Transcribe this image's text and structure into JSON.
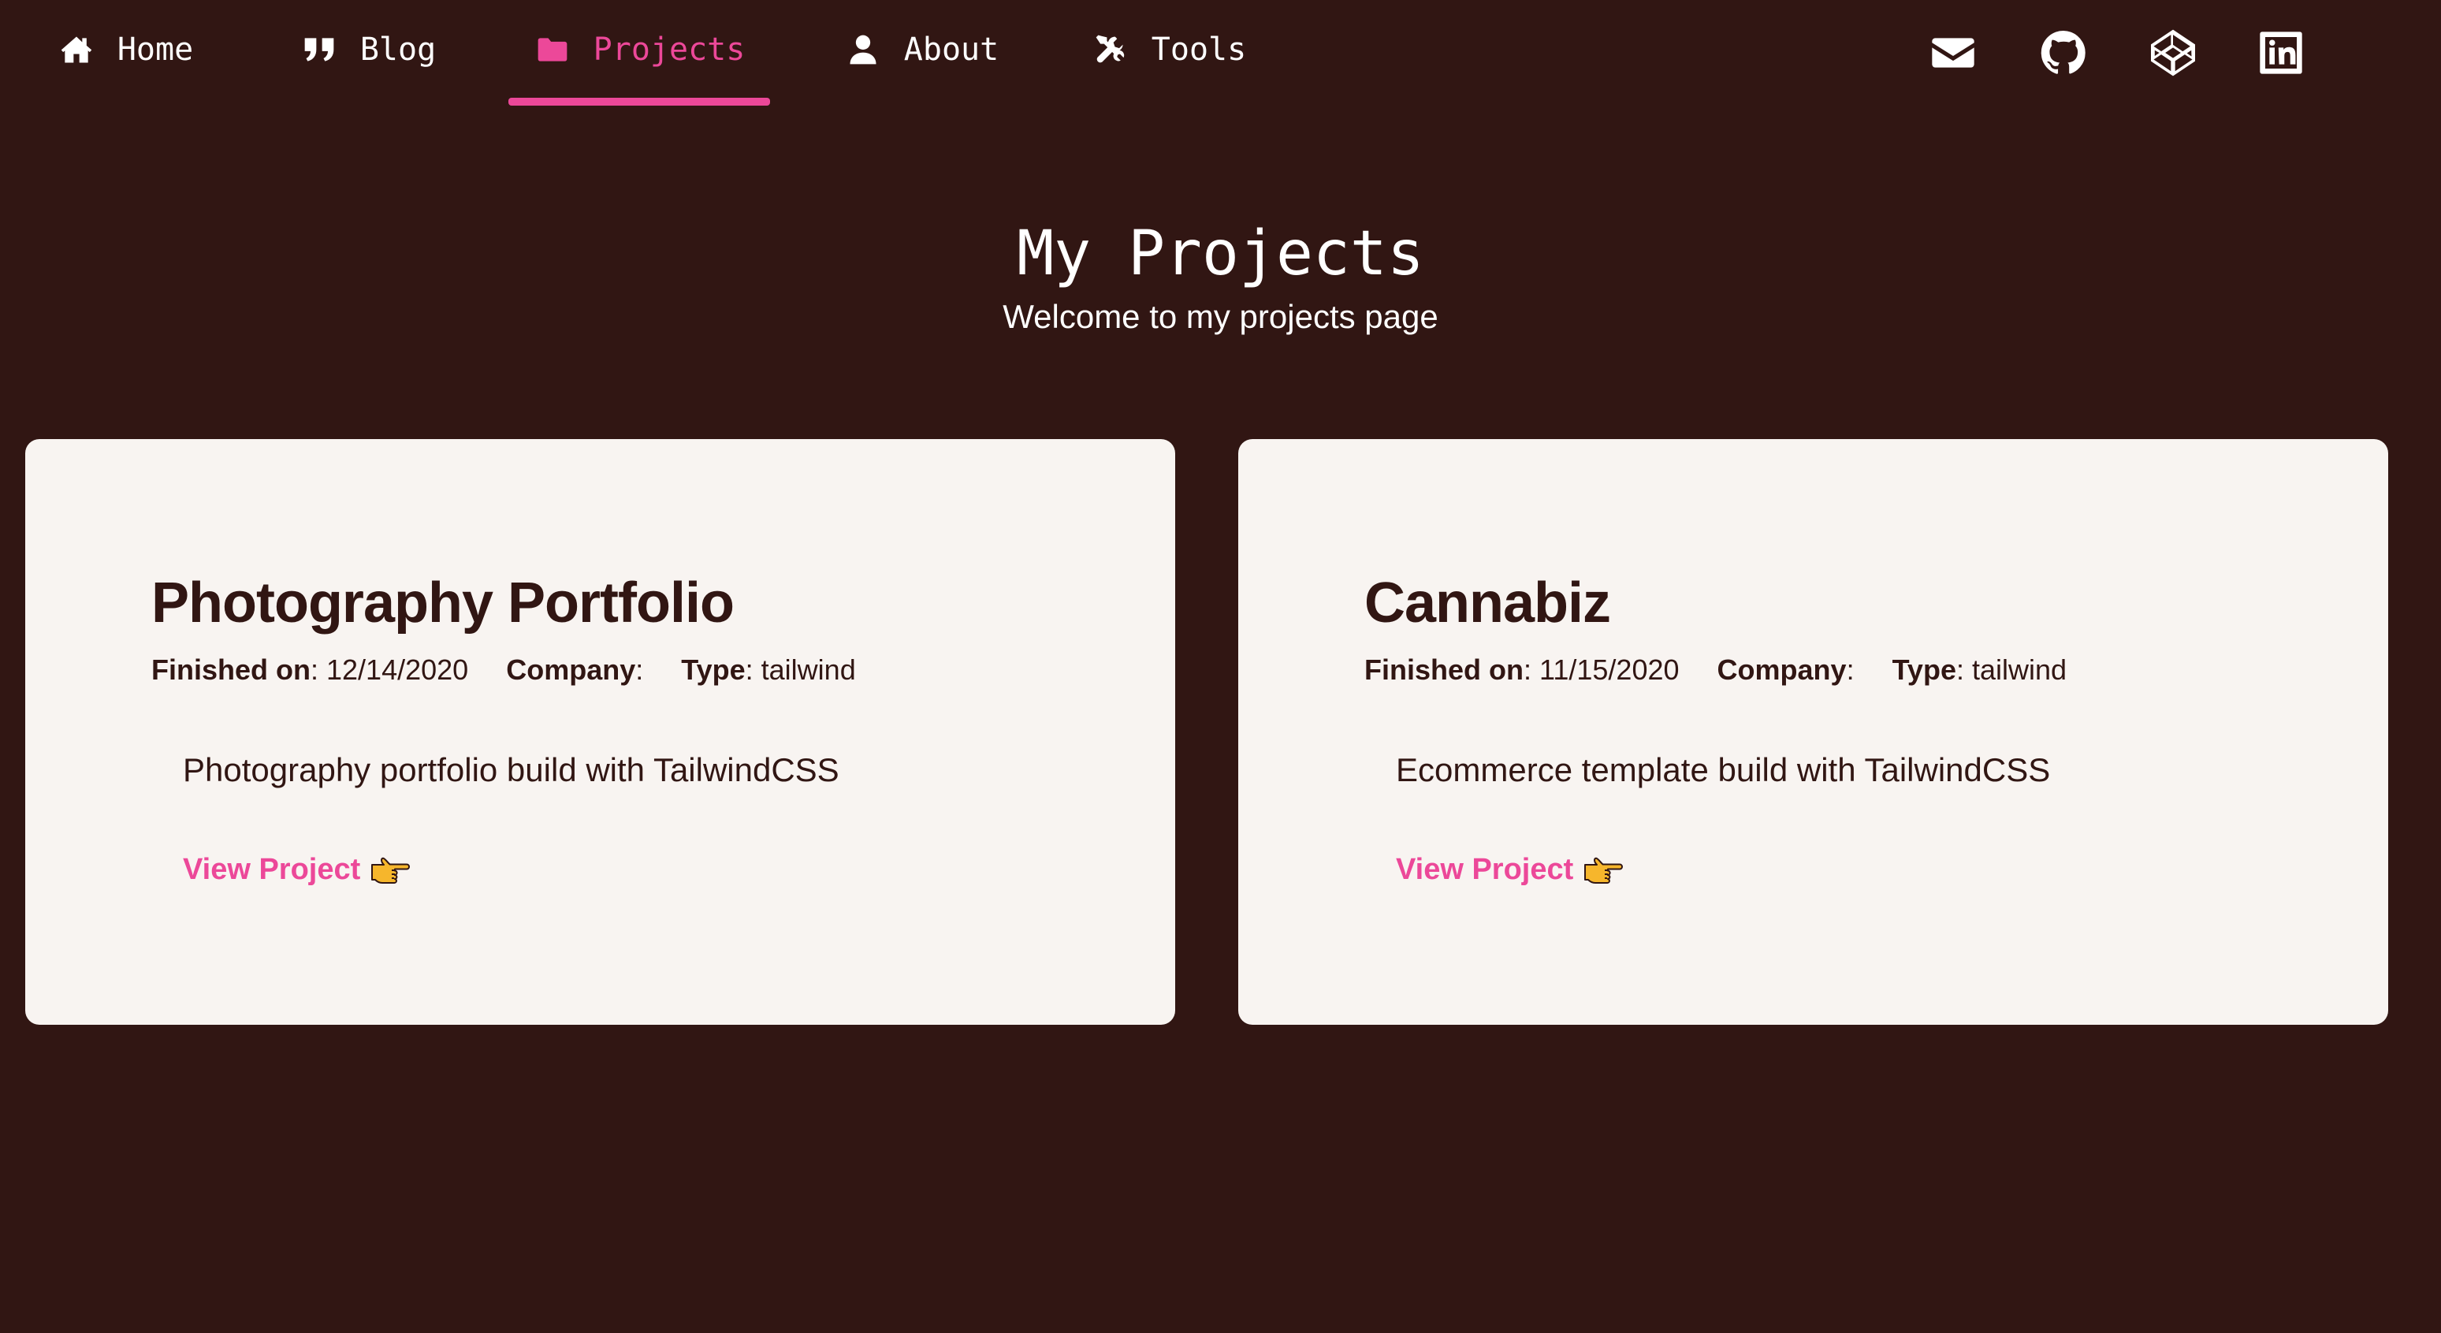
{
  "nav": {
    "items": [
      {
        "label": "Home",
        "icon": "home-icon",
        "active": false
      },
      {
        "label": "Blog",
        "icon": "quote-icon",
        "active": false
      },
      {
        "label": "Projects",
        "icon": "folder-icon",
        "active": true
      },
      {
        "label": "About",
        "icon": "user-icon",
        "active": false
      },
      {
        "label": "Tools",
        "icon": "tools-icon",
        "active": false
      }
    ],
    "social": [
      {
        "icon": "email-icon"
      },
      {
        "icon": "github-icon"
      },
      {
        "icon": "codepen-icon"
      },
      {
        "icon": "linkedin-icon"
      }
    ]
  },
  "header": {
    "title": "My Projects",
    "subtitle": "Welcome to my projects page"
  },
  "projects": [
    {
      "title": "Photography Portfolio",
      "finished_label": "Finished on",
      "finished_value": "12/14/2020",
      "company_label": "Company",
      "company_value": "",
      "type_label": "Type",
      "type_value": "tailwind",
      "description": "Photography portfolio build with TailwindCSS",
      "link_label": "View Project"
    },
    {
      "title": "Cannabiz",
      "finished_label": "Finished on",
      "finished_value": "11/15/2020",
      "company_label": "Company",
      "company_value": "",
      "type_label": "Type",
      "type_value": "tailwind",
      "description": "Ecommerce template build with TailwindCSS",
      "link_label": "View Project"
    }
  ],
  "colors": {
    "background": "#311613",
    "accent": "#ec4899",
    "card": "#f8f4f1",
    "card_text": "#311613"
  }
}
